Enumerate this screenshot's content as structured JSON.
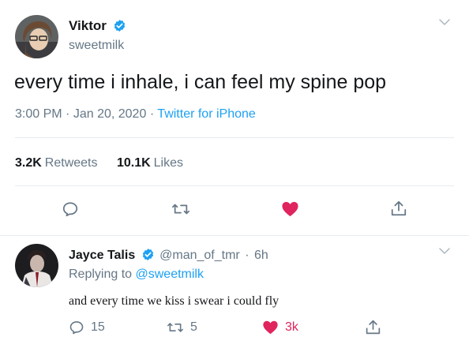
{
  "tweet": {
    "author_name": "Viktor",
    "author_handle": "sweetmilk",
    "text": "every time i inhale, i can feel my spine pop",
    "time": "3:00 PM",
    "date": "Jan 20, 2020",
    "source": "Twitter for iPhone",
    "separator": "·",
    "retweets_count": "3.2K",
    "retweets_label": "Retweets",
    "likes_count": "10.1K",
    "likes_label": "Likes",
    "liked": true
  },
  "reply": {
    "author_name": "Jayce Talis",
    "author_handle": "@man_of_tmr",
    "separator": "·",
    "time_ago": "6h",
    "replying_to_label": "Replying to",
    "replying_to_handle": "@sweetmilk",
    "text": "and every time we kiss i swear i could fly",
    "reply_count": "15",
    "retweet_count": "5",
    "like_count": "3k",
    "liked": true
  },
  "colors": {
    "accent": "#1da1f2",
    "like": "#e0245e",
    "muted": "#657786",
    "text": "#14171a",
    "divider": "#e6ecf0"
  },
  "icons": {
    "verified": "verified-badge-icon",
    "chevron": "chevron-down-icon",
    "reply": "reply-bubble-icon",
    "retweet": "retweet-icon",
    "like": "heart-icon",
    "share": "share-icon"
  }
}
